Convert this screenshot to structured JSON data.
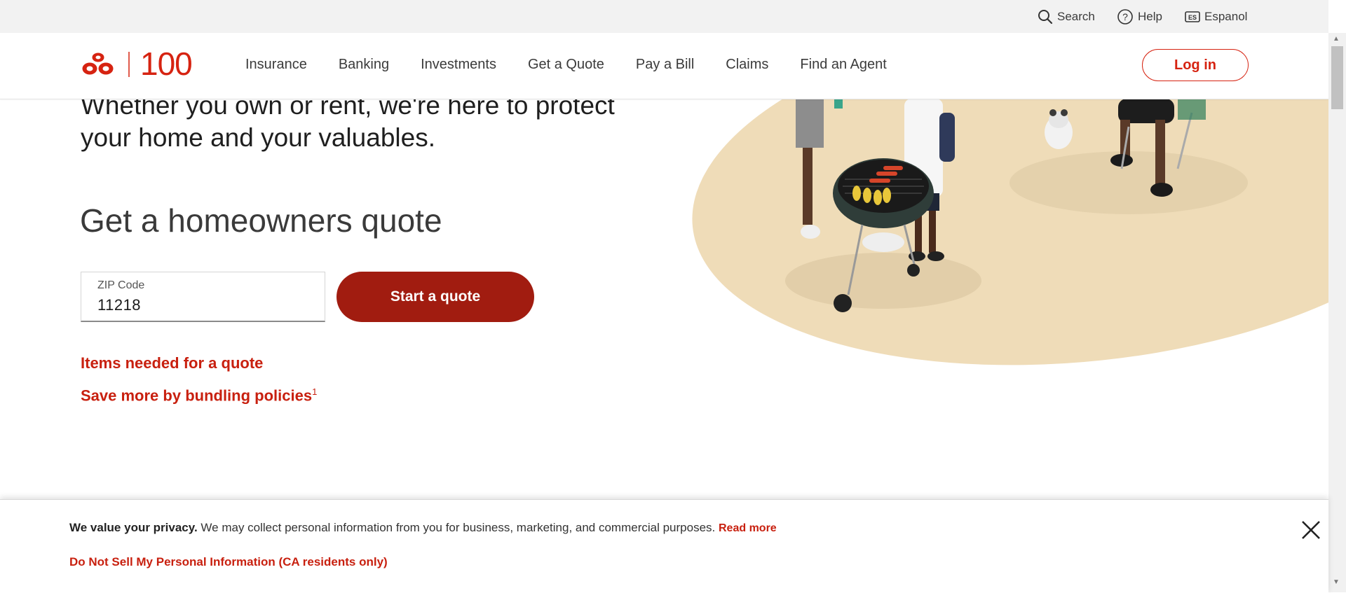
{
  "utility": {
    "search_label": "Search",
    "help_label": "Help",
    "espanol_label": "Espanol"
  },
  "header": {
    "logo_text": "100",
    "nav": [
      "Insurance",
      "Banking",
      "Investments",
      "Get a Quote",
      "Pay a Bill",
      "Claims",
      "Find an Agent"
    ],
    "login_label": "Log in"
  },
  "hero": {
    "subheading": "Whether you own or rent, we're here to protect your home and your valuables.",
    "quote_heading": "Get a homeowners quote",
    "zip_label": "ZIP Code",
    "zip_value": "11218",
    "start_button": "Start a quote",
    "items_link": "Items needed for a quote",
    "bundle_link": "Save more by bundling policies",
    "bundle_footnote": "1"
  },
  "privacy": {
    "bold_text": "We value your privacy.",
    "body_text": "We may collect personal information from you for business, marketing, and commercial purposes.",
    "read_more": "Read more",
    "do_not_sell": "Do Not Sell My Personal Information (CA residents only)"
  },
  "colors": {
    "brand_red": "#d62311",
    "button_dark_red": "#a11c10",
    "link_red": "#c8200f",
    "hero_ellipse": "#efdcb8"
  },
  "icons": [
    "search-icon",
    "help-icon",
    "language-es-icon",
    "close-icon"
  ]
}
